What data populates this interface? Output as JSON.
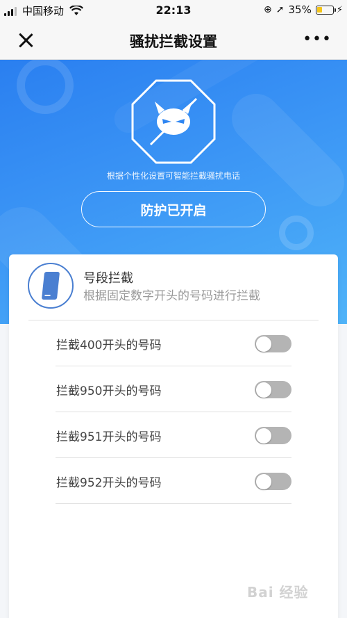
{
  "status_bar": {
    "carrier": "中国移动",
    "time": "22:13",
    "battery_percent": "35%",
    "battery_level": 0.35,
    "battery_color": "#f5c518",
    "icons": [
      "signal-icon",
      "wifi-icon",
      "lock-rotation-icon",
      "location-arrow-icon",
      "battery-icon",
      "charging-icon"
    ]
  },
  "nav": {
    "title": "骚扰拦截设置",
    "close_icon": "close-icon",
    "more_label": "•••"
  },
  "hero": {
    "subtitle": "根据个性化设置可智能拦截骚扰电话",
    "button_label": "防护已开启",
    "gradient_colors": [
      "#2a7ff0",
      "#4fb3f8"
    ]
  },
  "card": {
    "title": "号段拦截",
    "description": "根据固定数字开头的号码进行拦截",
    "icon_color": "#4a7fd1",
    "rows": [
      {
        "label": "拦截400开头的号码",
        "enabled": false
      },
      {
        "label": "拦截950开头的号码",
        "enabled": false
      },
      {
        "label": "拦截951开头的号码",
        "enabled": false
      },
      {
        "label": "拦截952开头的号码",
        "enabled": false
      }
    ]
  },
  "watermark": "Bai 经验"
}
